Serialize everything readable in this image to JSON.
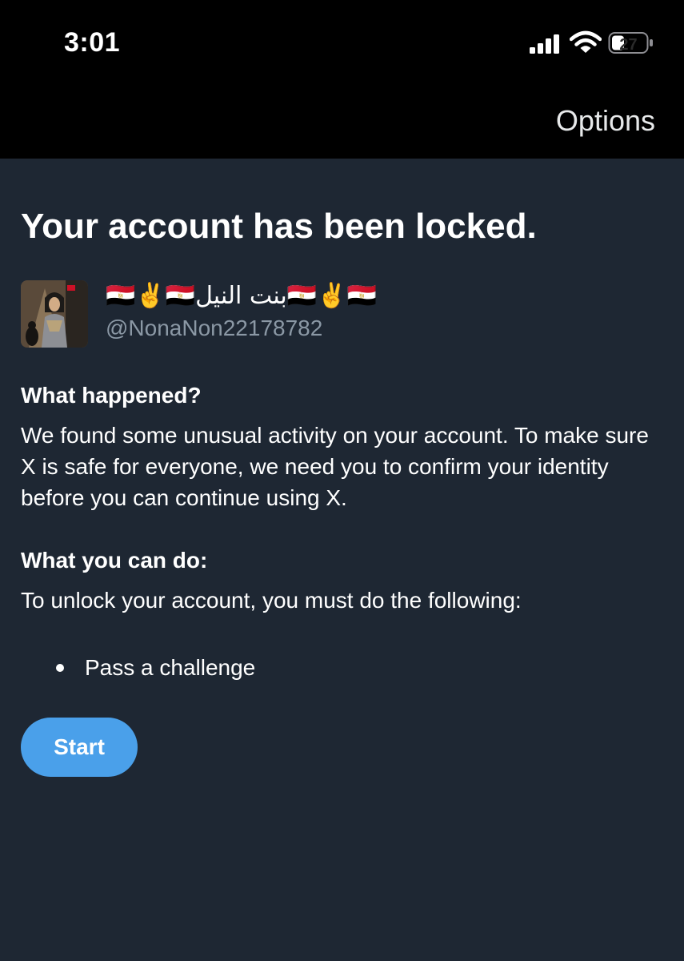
{
  "status_bar": {
    "time": "3:01",
    "battery": "27"
  },
  "nav": {
    "options_label": "Options"
  },
  "page": {
    "title": "Your account has been locked."
  },
  "account": {
    "display_name": "🇪🇬✌️🇪🇬بنت النيل🇪🇬✌️🇪🇬",
    "handle": "@NonaNon22178782",
    "avatar_icon": "profile-photo"
  },
  "what_happened": {
    "heading": "What happened?",
    "body": "We found some unusual activity on your account. To make sure X is safe for everyone, we need you to confirm your identity before you can continue using X."
  },
  "what_you_can_do": {
    "heading": "What you can do:",
    "body": "To unlock your account, you must do the following:",
    "items": [
      "Pass a challenge"
    ]
  },
  "actions": {
    "start_label": "Start"
  },
  "colors": {
    "background": "#1e2733",
    "bar": "#000000",
    "accent": "#4aa0ea",
    "secondary_text": "#8b98a5"
  }
}
